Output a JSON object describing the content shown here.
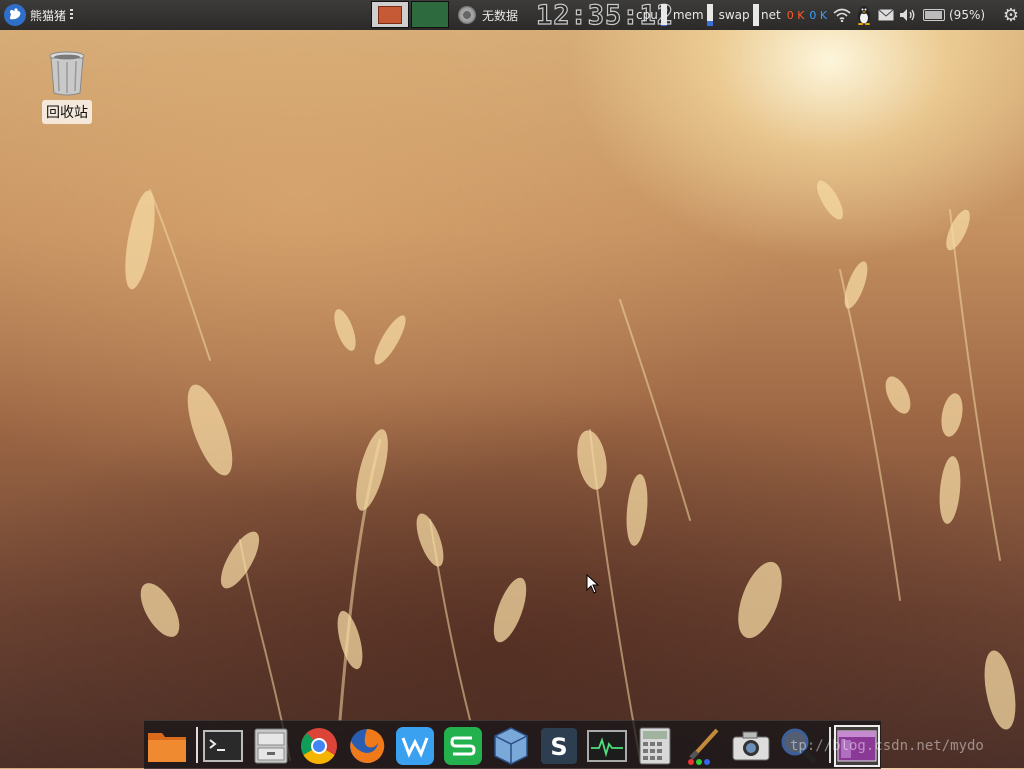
{
  "top_panel": {
    "menu_label": "熊猫猪",
    "weather_text": "无数据",
    "clock": "12:35:12",
    "cpu_label": "cpu",
    "mem_label": "mem",
    "swap_label": "swap",
    "cpu_usage": 0.03,
    "mem_usage": 0.25,
    "swap_usage": 0.0,
    "net_label": "net",
    "net_rx": "0 K",
    "net_tx": "0 K",
    "battery": "(95%)",
    "battery_level": 0.95
  },
  "desktop": {
    "trash_label": "回收站"
  },
  "dock": {
    "items": [
      {
        "name": "folder",
        "icon": "folder-icon"
      },
      {
        "name": "terminal",
        "icon": "terminal-icon"
      },
      {
        "name": "file-manager",
        "icon": "file-cabinet-icon"
      },
      {
        "name": "chrome",
        "icon": "chrome-icon"
      },
      {
        "name": "firefox",
        "icon": "firefox-icon"
      },
      {
        "name": "wps-writer",
        "icon": "wps-writer-icon"
      },
      {
        "name": "wps-spreadsheet",
        "icon": "wps-spreadsheet-icon"
      },
      {
        "name": "virtualbox",
        "icon": "virtualbox-icon"
      },
      {
        "name": "scrivener",
        "icon": "s-app-icon"
      },
      {
        "name": "system-monitor",
        "icon": "system-monitor-icon"
      },
      {
        "name": "calculator",
        "icon": "calculator-icon"
      },
      {
        "name": "paint",
        "icon": "paintbrush-icon"
      },
      {
        "name": "screenshot",
        "icon": "camera-icon"
      },
      {
        "name": "search",
        "icon": "magnifier-icon"
      },
      {
        "name": "active-window",
        "icon": "window-icon"
      }
    ]
  },
  "watermark": "tp://blog.csdn.net/mydo",
  "colors": {
    "panel_bg": "#2b2a28",
    "rx": "#ff5a2a",
    "tx": "#3aa0ff"
  }
}
